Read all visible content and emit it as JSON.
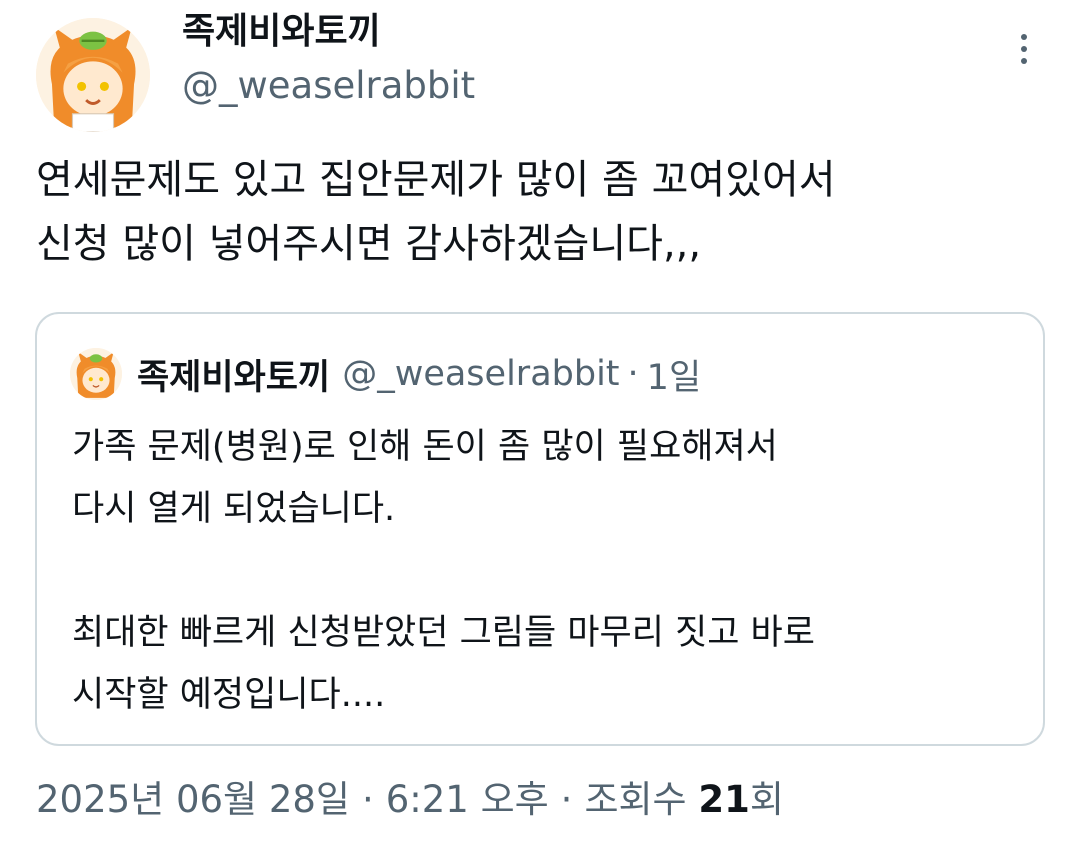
{
  "author": {
    "display_name": "족제비와토끼",
    "handle": "@_weaselrabbit",
    "avatar_icon": "avatar-illustration"
  },
  "tweet": {
    "text": "연세문제도 있고 집안문제가 많이 좀 꼬여있어서\n신청 많이 넣어주시면 감사하겠습니다,,,"
  },
  "quote": {
    "display_name": "족제비와토끼",
    "handle": "@_weaselrabbit",
    "separator": "·",
    "time": "1일",
    "text": "가족 문제(병원)로 인해 돈이 좀 많이 필요해져서\n다시 열게 되었습니다.\n\n최대한 빠르게 신청받았던 그림들 마무리 짓고 바로\n시작할 예정입니다...."
  },
  "meta": {
    "date": "2025년 06월 28일",
    "separator": "·",
    "time": "6:21 오후",
    "views_label": "조회수",
    "views_count": "21",
    "views_suffix": "회"
  },
  "colors": {
    "text_primary": "#0f1419",
    "text_secondary": "#536471",
    "border": "#cfd9de"
  },
  "icons": {
    "more": "more-vertical-icon"
  }
}
